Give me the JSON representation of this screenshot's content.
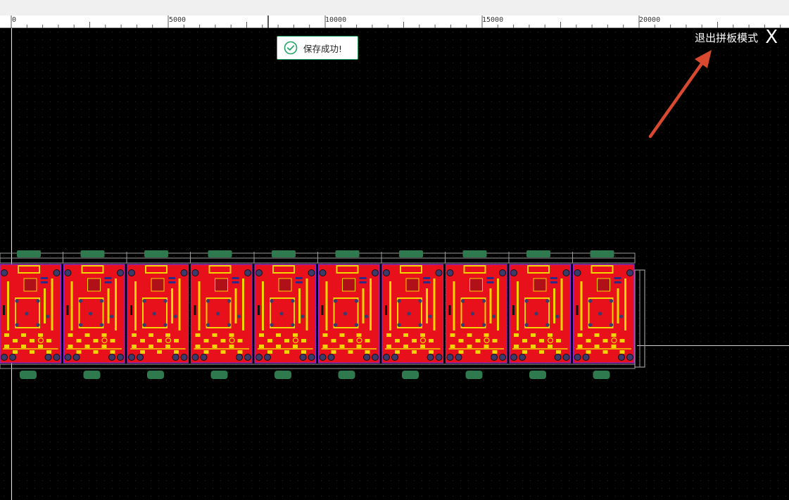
{
  "ruler": {
    "labels": [
      "0",
      "5000",
      "10000",
      "15000",
      "20000"
    ]
  },
  "toast": {
    "icon": "check-circle-icon",
    "message": "保存成功!"
  },
  "exit_panel_mode": {
    "label": "退出拼板模式",
    "close_glyph": "X"
  },
  "panel": {
    "board_count": 10,
    "colors": {
      "board_fill": "#e8101a",
      "trace_yellow": "#f2d400",
      "via_dark": "#3b3b6e",
      "tab_green": "#2e7a4e",
      "frame_gray": "#9a9a9a",
      "outline_purple": "#8a2be2"
    }
  },
  "annotation": {
    "arrow_color": "#d9492f"
  }
}
